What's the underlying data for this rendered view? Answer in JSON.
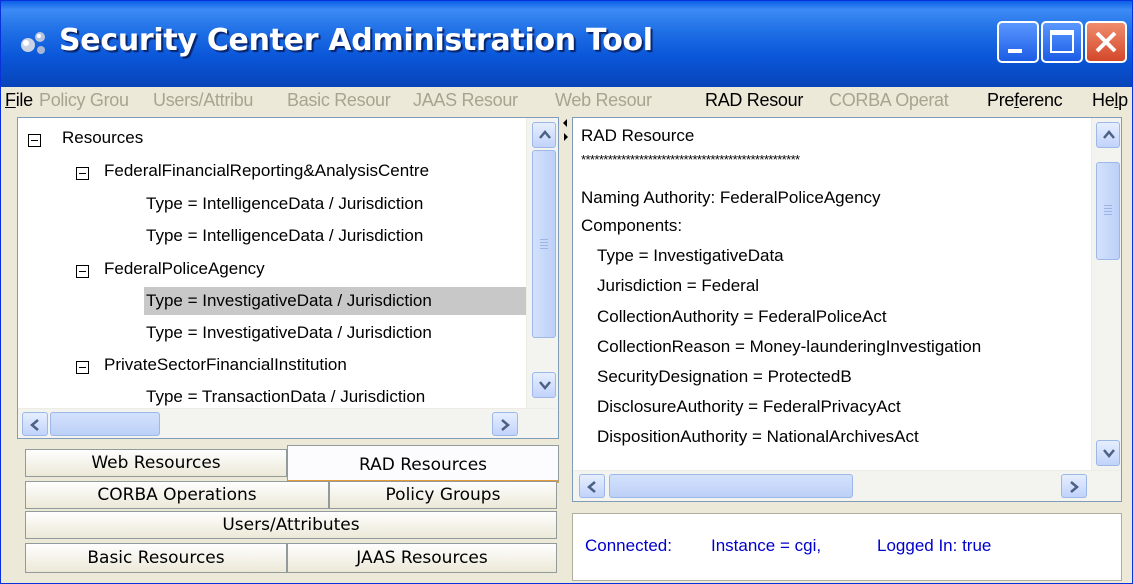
{
  "window": {
    "title": "Security Center Administration Tool"
  },
  "menu": [
    {
      "label": "File",
      "enabled": true,
      "mnemonic": "F",
      "rest": "ile"
    },
    {
      "label": "Policy Grou",
      "enabled": false
    },
    {
      "label": "Users/Attribu",
      "enabled": false
    },
    {
      "label": "Basic Resour",
      "enabled": false
    },
    {
      "label": "JAAS Resour",
      "enabled": false
    },
    {
      "label": "Web Resour",
      "enabled": false
    },
    {
      "label": "RAD Resour",
      "enabled": true
    },
    {
      "label": "CORBA Operat",
      "enabled": false
    },
    {
      "label": "Preferenc",
      "enabled": true,
      "pre": "Pre",
      "mnemonic": "f",
      "rest": "erenc"
    },
    {
      "label": "Help",
      "enabled": true,
      "pre": "He",
      "mnemonic": "l",
      "rest": "p"
    }
  ],
  "tree": {
    "root": "Resources",
    "nodes": [
      {
        "label": "FederalFinancialReporting&AnalysisCentre",
        "children": [
          "Type = IntelligenceData   /   Jurisdiction",
          "Type = IntelligenceData   /   Jurisdiction"
        ]
      },
      {
        "label": "FederalPoliceAgency",
        "children": [
          "Type = InvestigativeData   /   Jurisdiction",
          "Type = InvestigativeData   /   Jurisdiction"
        ]
      },
      {
        "label": "PrivateSectorFinancialInstitution",
        "children": [
          "Type = TransactionData   /   Jurisdiction"
        ]
      }
    ],
    "selected": "Type = InvestigativeData   /   Jurisdiction"
  },
  "detail": {
    "heading": "RAD Resource",
    "separator": "*************************************************",
    "naming_authority": "Naming Authority: FederalPoliceAgency",
    "components_label": "Components:",
    "components": [
      "Type = InvestigativeData",
      "Jurisdiction = Federal",
      "CollectionAuthority = FederalPoliceAct",
      "CollectionReason = Money-launderingInvestigation",
      "SecurityDesignation = ProtectedB",
      "DisclosureAuthority = FederalPrivacyAct",
      "DispositionAuthority = NationalArchivesAct"
    ]
  },
  "tabs": {
    "web": "Web Resources",
    "rad": "RAD Resources",
    "corba": "CORBA Operations",
    "policy": "Policy Groups",
    "users": "Users/Attributes",
    "basic": "Basic Resources",
    "jaas": "JAAS Resources",
    "active": "RAD Resources"
  },
  "status": {
    "connected": "Connected:",
    "instance": "Instance = cgi,",
    "logged_in": "Logged In: true",
    "color": "#0000cc"
  },
  "icons": {
    "app": "app-icon",
    "minimize": "minimize-icon",
    "maximize": "maximize-icon",
    "close": "close-icon",
    "scroll_up": "arrow-up-icon",
    "scroll_down": "arrow-down-icon",
    "scroll_left": "arrow-left-icon",
    "scroll_right": "arrow-right-icon"
  },
  "colors": {
    "titlebar": "#0a56d9",
    "selection": "#c8c8c8",
    "tab_accent": "#e69a38",
    "disabled_menu": "#a7a590"
  }
}
